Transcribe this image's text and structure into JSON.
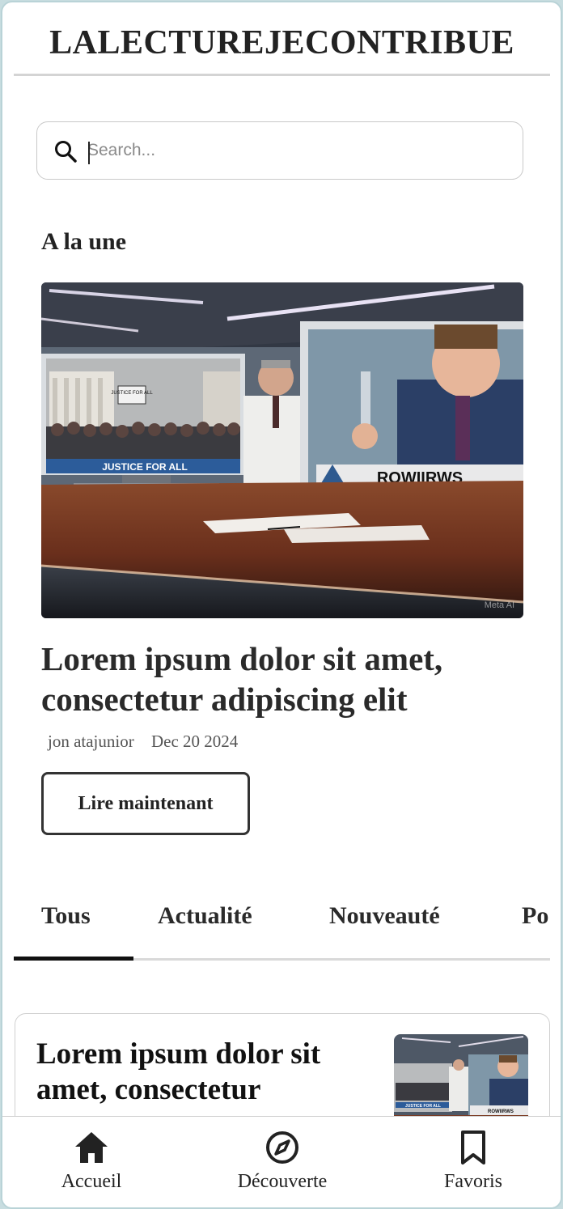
{
  "app": {
    "brand": "LALECTUREJECONTRIBUE"
  },
  "search": {
    "placeholder": "Search...",
    "value": ""
  },
  "featured": {
    "section_title": "A la une",
    "image_caption_left": "JUSTICE FOR ALL",
    "image_caption_right": "ROWIIRWS",
    "image_sign": "JUSTICE FOR ALL",
    "image_watermark": "Meta AI",
    "title": "Lorem ipsum dolor sit amet, consectetur adipiscing elit",
    "author": "jon atajunior",
    "date": "Dec 20 2024",
    "cta_label": "Lire maintenant"
  },
  "tabs": [
    {
      "label": "Tous",
      "active": true
    },
    {
      "label": "Actualité",
      "active": false
    },
    {
      "label": "Nouveauté",
      "active": false
    },
    {
      "label": "Po",
      "active": false
    }
  ],
  "article_card": {
    "title": "Lorem ipsum dolor sit amet, consectetur",
    "thumb_caption_left": "JUSTICE FOR ALL",
    "thumb_caption_right": "ROWIIRWS"
  },
  "bottom_nav": [
    {
      "label": "Accueil",
      "icon": "home-icon"
    },
    {
      "label": "Découverte",
      "icon": "compass-icon"
    },
    {
      "label": "Favoris",
      "icon": "bookmark-icon"
    }
  ],
  "colors": {
    "text": "#222222",
    "border": "#cfcfcf",
    "accent_blue": "#2f5a8f",
    "desk_wood": "#7a3a22"
  }
}
